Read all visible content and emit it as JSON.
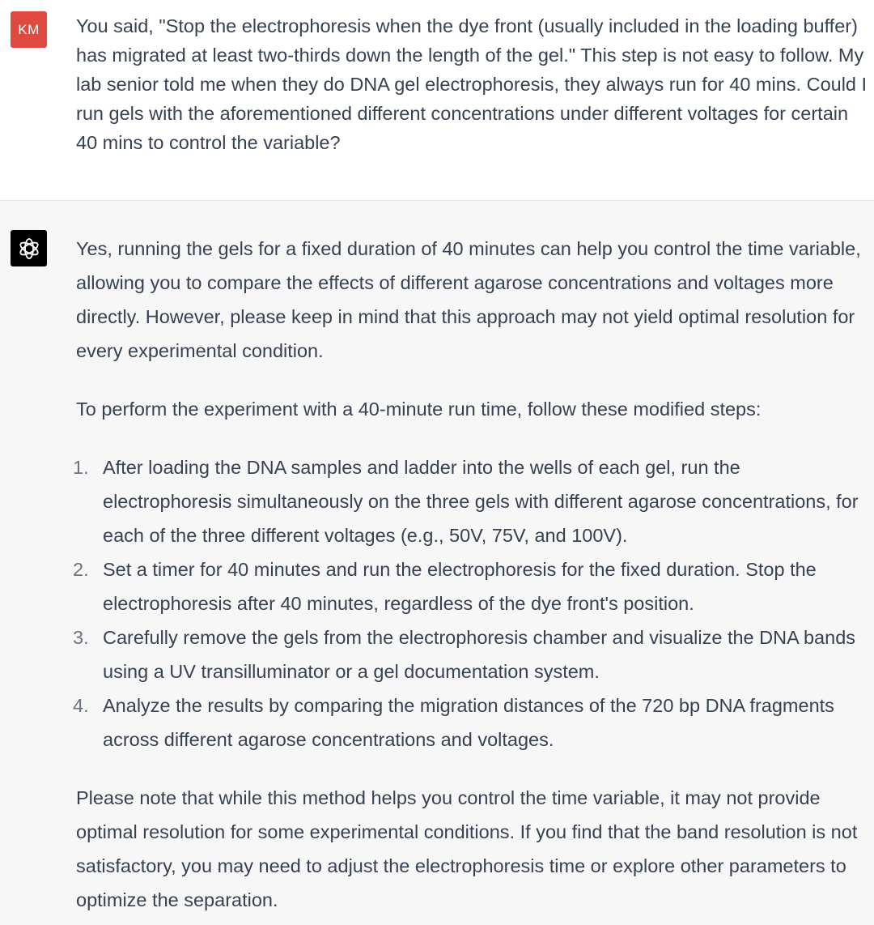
{
  "user_message": {
    "avatar_initials": "KM",
    "text": "You said, \"Stop the electrophoresis when the dye front (usually included in the loading buffer) has migrated at least two-thirds down the length of the gel.\" This step is not easy to follow. My lab senior told me when they do DNA gel electrophoresis, they always run for 40 mins. Could I run gels with the aforementioned different concentrations under different voltages for certain 40 mins to control the variable?"
  },
  "assistant_message": {
    "intro": "Yes, running the gels for a fixed duration of 40 minutes can help you control the time variable, allowing you to compare the effects of different agarose concentrations and voltages more directly. However, please keep in mind that this approach may not yield optimal resolution for every experimental condition.",
    "steps_lead": "To perform the experiment with a 40-minute run time, follow these modified steps:",
    "steps": [
      {
        "num": "1.",
        "text": "After loading the DNA samples and ladder into the wells of each gel, run the electrophoresis simultaneously on the three gels with different agarose concentrations, for each of the three different voltages (e.g., 50V, 75V, and 100V)."
      },
      {
        "num": "2.",
        "text": "Set a timer for 40 minutes and run the electrophoresis for the fixed duration. Stop the electrophoresis after 40 minutes, regardless of the dye front's position."
      },
      {
        "num": "3.",
        "text": "Carefully remove the gels from the electrophoresis chamber and visualize the DNA bands using a UV transilluminator or a gel documentation system."
      },
      {
        "num": "4.",
        "text": "Analyze the results by comparing the migration distances of the 720 bp DNA fragments across different agarose concentrations and voltages."
      }
    ],
    "closing": "Please note that while this method helps you control the time variable, it may not provide optimal resolution for some experimental conditions. If you find that the band resolution is not satisfactory, you may need to adjust the electrophoresis time or explore other parameters to optimize the separation."
  },
  "colors": {
    "user_avatar_bg": "#e0493f",
    "bot_avatar_bg": "#000000",
    "assistant_bg": "#f7f7f8",
    "text": "#374151"
  },
  "icons": {
    "bot_avatar": "openai-logo-icon"
  }
}
